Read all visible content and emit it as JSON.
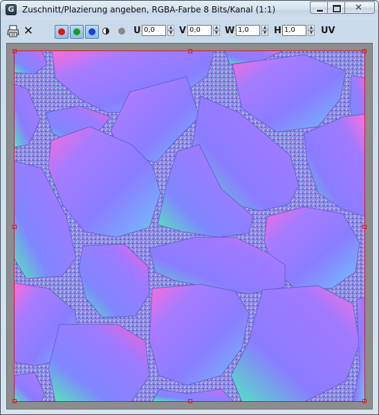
{
  "window": {
    "title": "Zuschnitt/Plazierung angeben, RGBA-Farbe 8 Bits/Kanal (1:1)",
    "app_icon_glyph": "G"
  },
  "toolbar": {
    "icons": [
      "printer-icon",
      "close-icon",
      "red-channel-icon",
      "green-channel-icon",
      "blue-channel-icon",
      "monochrome-icon",
      "alpha-channel-icon"
    ],
    "channel_colors": {
      "red": "#e01515",
      "green": "#159e2a",
      "blue": "#1c3ed9"
    },
    "fields": {
      "u_label": "U",
      "u_value": "0,0",
      "v_label": "V",
      "v_value": "0,0",
      "w_label": "W",
      "w_value": "1,0",
      "h_label": "H",
      "h_value": "1,0"
    },
    "uv_label": "UV",
    "close_glyph": "✕"
  },
  "colors": {
    "crop_border": "#d0182a",
    "texture_base": "#8a86e6",
    "stone_purple": "#8c78ff",
    "stone_green": "#4cf0a8",
    "stone_pink": "#ff5ad8"
  }
}
